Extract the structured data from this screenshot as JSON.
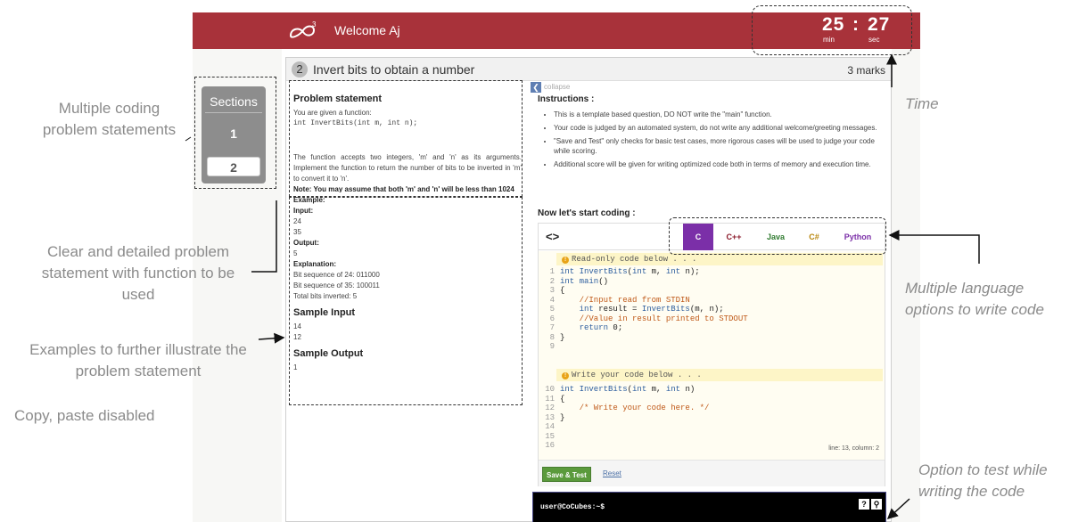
{
  "header": {
    "welcome": "Welcome Aj",
    "logo_sup": "3"
  },
  "timer": {
    "minutes": "25",
    "separator": ":",
    "seconds": "27",
    "min_label": "min",
    "sec_label": "sec"
  },
  "sections": {
    "title": "Sections",
    "items": [
      "1",
      "2"
    ]
  },
  "question": {
    "number": "2",
    "title": "Invert bits to obtain a number",
    "marks": "3 marks"
  },
  "problem": {
    "heading": "Problem statement",
    "line1": "You are given a function:",
    "signature": "int InvertBits(int m, int n);",
    "para1": "The function accepts two integers, 'm' and 'n' as its arguments. Implement the function to return the number of bits to be inverted in 'm' to convert it to 'n'.",
    "note": "Note: You may assume that both 'm' and 'n' will be less than 1024",
    "example_label": "Example:",
    "input_label": "Input:",
    "input_values": [
      "24",
      "35"
    ],
    "output_label": "Output:",
    "output_value": "5",
    "explanation_label": "Explanation:",
    "explanation": [
      "Bit sequence of 24: 011000",
      "Bit sequence of 35: 100011",
      "Total bits inverted: 5"
    ],
    "sample_input_heading": "Sample Input",
    "sample_input": [
      "14",
      "12"
    ],
    "sample_output_heading": "Sample Output",
    "sample_output": "1"
  },
  "instructions": {
    "collapse": "collapse",
    "heading": "Instructions :",
    "items": [
      "This is a template based question, DO NOT write the \"main\" function.",
      "Your code is judged by an automated system, do not write any additional welcome/greeting messages.",
      "\"Save and Test\" only checks for basic test cases, more rigorous cases will be used to judge your code while scoring.",
      "Additional score will be given for writing optimized code both in terms of memory and execution time."
    ],
    "start_coding": "Now let's start coding :"
  },
  "editor": {
    "code_icon": "<>",
    "languages": [
      "C",
      "C++",
      "Java",
      "C#",
      "Python"
    ],
    "active_language": "C",
    "language_colors": {
      "C": "#ffffff",
      "C++": "#8b1a2b",
      "Java": "#2f7a2f",
      "C#": "#b8860b",
      "Python": "#7b2fa8"
    },
    "readonly_banner": "Read-only code below . . .",
    "write_banner": "Write your code below . . .",
    "readonly_lines": [
      {
        "n": "1",
        "code": "int InvertBits(int m, int n);"
      },
      {
        "n": "2",
        "code": "int main()"
      },
      {
        "n": "3",
        "code": "{"
      },
      {
        "n": "4",
        "code": "    //Input read from STDIN"
      },
      {
        "n": "5",
        "code": "    int result = InvertBits(m, n);"
      },
      {
        "n": "6",
        "code": "    //Value in result printed to STDOUT"
      },
      {
        "n": "7",
        "code": "    return 0;"
      },
      {
        "n": "8",
        "code": "}"
      },
      {
        "n": "9",
        "code": ""
      }
    ],
    "write_lines": [
      {
        "n": "10",
        "code": "int InvertBits(int m, int n)"
      },
      {
        "n": "11",
        "code": "{"
      },
      {
        "n": "12",
        "code": "    /* Write your code here. */"
      },
      {
        "n": "13",
        "code": "}"
      },
      {
        "n": "14",
        "code": ""
      },
      {
        "n": "15",
        "code": ""
      },
      {
        "n": "16",
        "code": ""
      }
    ],
    "status": "line: 13, column: 2",
    "save_test": "Save & Test",
    "reset": "Reset"
  },
  "terminal": {
    "prompt": "user@CoCubes:~$",
    "help_icon": "?"
  },
  "callouts": {
    "sections": "Multiple coding problem statements",
    "problem": "Clear and detailed problem statement with function to be used",
    "examples": "Examples to further illustrate the problem statement",
    "copy": "Copy, paste disabled",
    "time": "Time",
    "languages": "Multiple language options to write code",
    "test": "Option to test while writing the code"
  },
  "colors": {
    "header": "#a8323a",
    "active_tab": "#7b2fa8",
    "save_button": "#5a9a3c"
  }
}
